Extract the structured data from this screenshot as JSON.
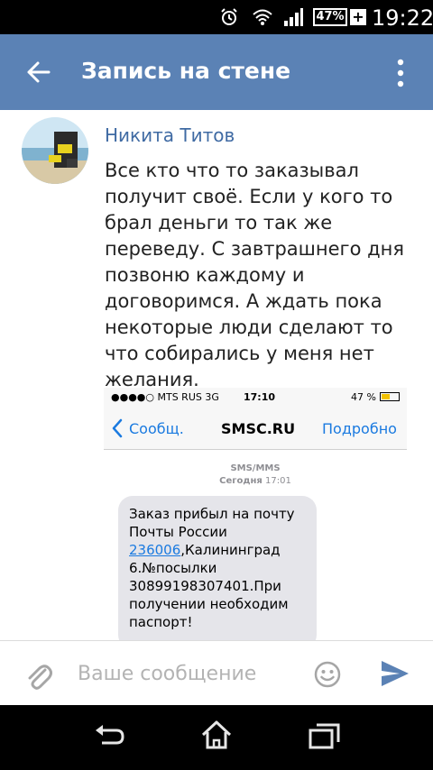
{
  "status_bar": {
    "battery": "47%",
    "charging": "+",
    "time": "19:22"
  },
  "toolbar": {
    "title": "Запись на стене"
  },
  "post": {
    "author": "Никита Титов",
    "text_lines": [
      "Все кто что то заказывал",
      "получит своё. Если у кого то",
      "брал деньги то так же",
      "переведу. С завтрашнего дня",
      "позвоню каждому и",
      "договоримся. А ждать пока",
      "некоторые люди сделают то",
      "что собирались у меня нет",
      "желания."
    ]
  },
  "attachment": {
    "ios_status": {
      "carrier": "●●●●○ MTS RUS  3G",
      "time": "17:10",
      "battery": "47 %"
    },
    "ios_nav": {
      "back": "Сообщ.",
      "title": "SMSC.RU",
      "details": "Подробно"
    },
    "sms_type": "SMS/MMS",
    "sms_date_day": "Сегодня",
    "sms_date_time": "17:01",
    "message": {
      "part1": "Заказ прибыл на почту Почты России ",
      "link": "236006",
      "part2": ",Калининград 6.№посылки 30899198307401.При получении необходим паспорт!"
    }
  },
  "composer": {
    "placeholder": "Ваше сообщение"
  },
  "colors": {
    "toolbar": "#5b82b5",
    "author": "#3f6aa3",
    "ios_blue": "#1a7ae0",
    "bubble": "#e5e5ea"
  }
}
